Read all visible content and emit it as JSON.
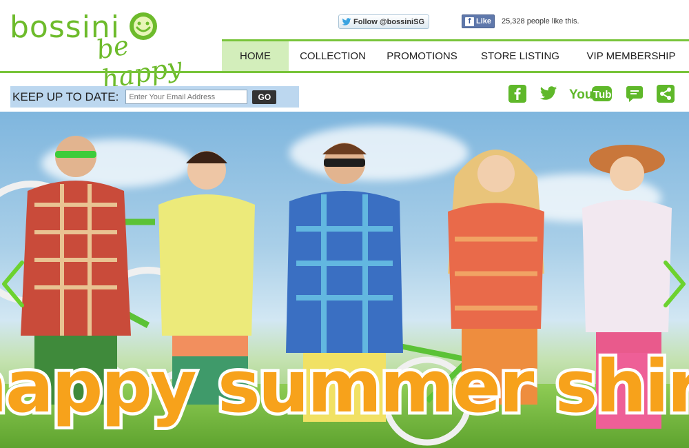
{
  "brand": {
    "name": "bossini",
    "slogan": "be happy",
    "accent_color": "#78c43a",
    "logo_green": "#6dbb2b"
  },
  "social_bar": {
    "twitter_label": "Follow @bossiniSG",
    "facebook_label": "Like",
    "facebook_count": "25,328 people like this."
  },
  "nav": {
    "items": [
      {
        "label": "HOME",
        "active": true
      },
      {
        "label": "COLLECTION",
        "active": false
      },
      {
        "label": "PROMOTIONS",
        "active": false
      },
      {
        "label": "STORE LISTING",
        "active": false
      },
      {
        "label": "VIP MEMBERSHIP",
        "active": false
      }
    ]
  },
  "newsletter": {
    "label": "KEEP UP TO DATE:",
    "placeholder": "Enter Your Email Address",
    "button_label": "GO"
  },
  "social_icons": [
    {
      "name": "facebook-icon"
    },
    {
      "name": "twitter-icon"
    },
    {
      "name": "youtube-icon"
    },
    {
      "name": "chat-icon"
    },
    {
      "name": "share-icon"
    }
  ],
  "hero": {
    "headline": "happy summer shirt",
    "prev_icon": "chevron-left-icon",
    "next_icon": "chevron-right-icon"
  }
}
